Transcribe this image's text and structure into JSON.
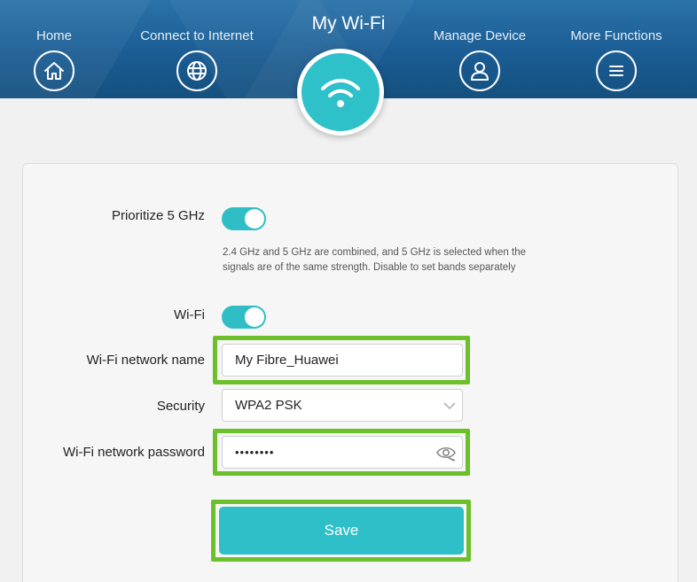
{
  "header": {
    "nav": [
      {
        "label": "Home",
        "icon": "home-icon"
      },
      {
        "label": "Connect to Internet",
        "icon": "globe-icon"
      },
      {
        "label": "My Wi-Fi",
        "icon": "wifi-icon",
        "active": true
      },
      {
        "label": "Manage Device",
        "icon": "user-icon"
      },
      {
        "label": "More Functions",
        "icon": "menu-icon"
      }
    ]
  },
  "form": {
    "prioritize_label": "Prioritize 5 GHz",
    "prioritize_on": true,
    "prioritize_hint": "2.4 GHz and 5 GHz are combined, and 5 GHz is selected when the signals are of the same strength. Disable to set bands separately",
    "wifi_label": "Wi-Fi",
    "wifi_on": true,
    "name_label": "Wi-Fi network name",
    "name_value": "My Fibre_Huawei",
    "security_label": "Security",
    "security_value": "WPA2 PSK",
    "password_label": "Wi-Fi network password",
    "password_value": "••••••••",
    "save_label": "Save"
  },
  "colors": {
    "header": "#1a5c93",
    "accent": "#2ebfc8",
    "highlight": "#6cc12a"
  }
}
